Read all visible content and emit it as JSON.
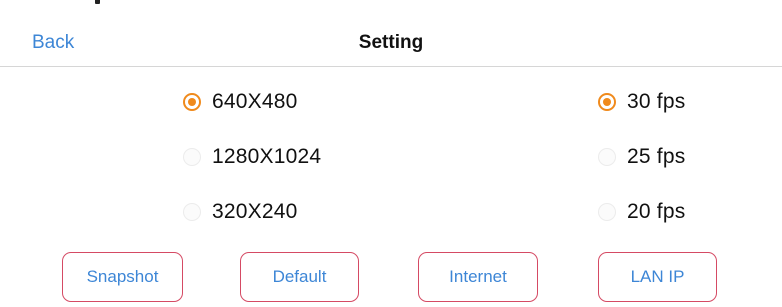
{
  "header": {
    "back_label": "Back",
    "title": "Setting"
  },
  "resolution": {
    "options": [
      {
        "label": "640X480",
        "selected": true
      },
      {
        "label": "1280X1024",
        "selected": false
      },
      {
        "label": "320X240",
        "selected": false
      }
    ]
  },
  "framerate": {
    "options": [
      {
        "label": "30 fps",
        "selected": true
      },
      {
        "label": "25 fps",
        "selected": false
      },
      {
        "label": "20 fps",
        "selected": false
      }
    ]
  },
  "buttons": {
    "snapshot": "Snapshot",
    "default": "Default",
    "internet": "Internet",
    "lan_ip": "LAN IP"
  },
  "colors": {
    "accent": "#f08a1c",
    "link": "#3d86d6",
    "button_border": "#d54a64"
  }
}
